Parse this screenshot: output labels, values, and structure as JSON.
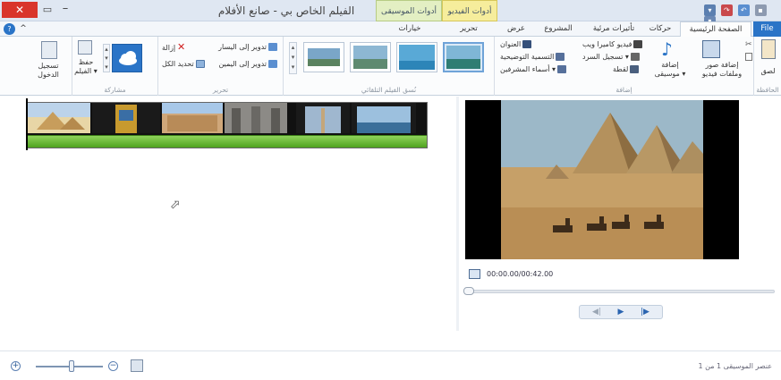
{
  "window": {
    "title": "الفيلم الخاص بي - صانع الأفلام",
    "close_glyph": "✕",
    "maximize_glyph": "▭",
    "minimize_glyph": "–"
  },
  "contextual_tabs": {
    "music_tools": "أدوات الموسيقى",
    "video_tools": "أدوات الفيديو"
  },
  "tabs": {
    "file": "File",
    "home": "الصفحة الرئيسية",
    "animations": "حركات",
    "visual_effects": "تأثيرات مرئية",
    "project": "المشروع",
    "view": "عرض",
    "edit": "تحرير",
    "options": "خيارات",
    "help_glyph": "?",
    "collapse_glyph": "^"
  },
  "ribbon": {
    "clipboard": {
      "group_label": "الحافظة",
      "paste": "لصق",
      "cut_icon": "cut-icon",
      "copy_icon": "copy-icon"
    },
    "add": {
      "group_label": "إضافة",
      "add_videos_photos_line1": "إضافة صور",
      "add_videos_photos_line2": "وملفات فيديو",
      "add_music_line1": "إضافة",
      "add_music_line2": "موسيقى ▾",
      "webcam_video": "فيديو كاميرا ويب",
      "record_narration": "تسجيل السرد ▾",
      "snapshot": "لقطة",
      "title": "العنوان",
      "caption": "التسمية التوضيحية",
      "credits": "أسماء المشرفين ▾"
    },
    "automovie": {
      "group_label": "نُسق الفيلم التلقائي"
    },
    "editing": {
      "group_label": "تحرير",
      "rotate_left": "تدوير إلى اليسار",
      "rotate_right": "تدوير إلى اليمين",
      "remove": "إزالة",
      "select_all": "تحديد الكل"
    },
    "share": {
      "group_label": "مشاركة",
      "save_movie_line1": "حفظ",
      "save_movie_line2": "الفيلم ▾"
    },
    "signin": {
      "label_line1": "تسجيل",
      "label_line2": "الدخول"
    }
  },
  "preview": {
    "time": "00:00.00/00:42.00",
    "prev_glyph": "◀|",
    "play_glyph": "▶",
    "next_glyph": "|▶"
  },
  "statusbar": {
    "status": "عنصر الموسيقى 1 من 1",
    "zoom_in_glyph": "+",
    "zoom_out_glyph": "−"
  },
  "colors": {
    "file_tab": "#2a74c7",
    "close_button": "#d9352b",
    "music_tools": "#e3efc3",
    "video_tools": "#f6ed9c",
    "music_track": "#5cb22a"
  }
}
